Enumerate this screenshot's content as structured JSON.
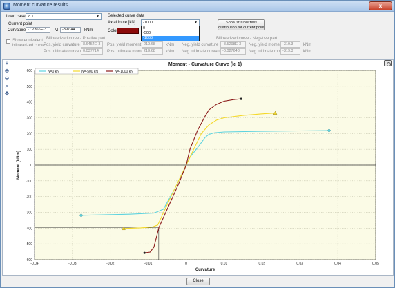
{
  "window": {
    "title": "Moment curvature results",
    "close_glyph": "x"
  },
  "load_case": {
    "label": "Load case",
    "value": "lc 1"
  },
  "current_point": {
    "heading": "Current point",
    "curvature_label": "Curvature",
    "curvature_value": "-7.2366E-3",
    "moment_label": "M",
    "moment_value": "-397.44",
    "unit": "kNm"
  },
  "selected_curve": {
    "heading": "Selected curve data",
    "axial_label": "Axial force [kN]",
    "axial_value": "-1000",
    "options": [
      "0",
      "-500",
      "-1000"
    ],
    "selected_option_index": 2,
    "color_label": "Color",
    "color_value": "#8b0a0a"
  },
  "show_button": {
    "line1": "Show strain/stress",
    "line2": "distribution for current point"
  },
  "equivalent": {
    "checkbox_label_1": "Show equivalent",
    "checkbox_label_2": "bilinearized curve"
  },
  "bilinear_pos": {
    "heading": "Bilinearized curve - Positive part",
    "yield_curv_label": "Pos. yield curvature",
    "yield_curv_value": "8.6454E-3",
    "ult_curv_label": "Pos. ultimate curvature",
    "ult_curv_value": "0.037714",
    "yield_mom_label": "Pos. yield moment",
    "yield_mom_value": "219.68",
    "ult_mom_label": "Pos. ultimate moment",
    "ult_mom_value": "219.68",
    "unit": "kNm"
  },
  "bilinear_neg": {
    "heading": "Bilinearized curve - Negative part",
    "yield_curv_label": "Neg. yield curvature",
    "yield_curv_value": "-8.5298E-3",
    "ult_curv_label": "Neg. ultimate curvature",
    "ult_curv_value": "-0.027648",
    "yield_mom_label": "Neg. yield moment",
    "yield_mom_value": "-319.3",
    "ult_mom_label": "Neg. ultimate moment",
    "ult_mom_value": "-319.3",
    "unit": "kNm"
  },
  "toolbar_icons": [
    "zoom-fit-icon",
    "zoom-in-icon",
    "zoom-out-icon",
    "zoom-window-icon",
    "pan-icon"
  ],
  "footer": {
    "close_label": "Close"
  },
  "chart_data": {
    "type": "line",
    "title": "Moment - Curvature Curve (lc 1)",
    "xlabel": "Curvature",
    "ylabel": "Moment [kNm]",
    "xlim": [
      -0.04,
      0.05
    ],
    "ylim": [
      -600,
      600
    ],
    "x_ticks": [
      -0.04,
      -0.03,
      -0.02,
      -0.01,
      0,
      0.01,
      0.02,
      0.03,
      0.04,
      0.05
    ],
    "y_ticks": [
      -600,
      -500,
      -400,
      -300,
      -200,
      -100,
      0,
      100,
      200,
      300,
      400,
      500,
      600
    ],
    "x_tick_labels": [
      "-0.04",
      "-0.03",
      "-0.02",
      "-0.01",
      "0",
      "0.01",
      "0.02",
      "0.03",
      "0.04",
      "0.05"
    ],
    "y_tick_labels": [
      "-600",
      "-500",
      "-400",
      "-300",
      "-200",
      "-100",
      "0",
      "100",
      "200",
      "300",
      "400",
      "500",
      "600"
    ],
    "grid": true,
    "legend_position": "top-left",
    "background": "#fbfbe6",
    "series": [
      {
        "name": "N=0 kN",
        "color": "#5ed3df",
        "marker": "diamond",
        "x": [
          -0.0277,
          -0.015,
          -0.0085,
          -0.006,
          -0.003,
          -0.001,
          0,
          0.001,
          0.003,
          0.005,
          0.006,
          0.0075,
          0.01,
          0.02,
          0.03,
          0.0377
        ],
        "y": [
          -319,
          -312,
          -305,
          -280,
          -150,
          -50,
          0,
          50,
          110,
          175,
          195,
          205,
          210,
          214,
          217,
          219
        ]
      },
      {
        "name": "N=-500 kN",
        "color": "#f4d82a",
        "marker": "triangle",
        "x": [
          -0.0165,
          -0.012,
          -0.009,
          -0.0075,
          -0.005,
          -0.002,
          0,
          0.002,
          0.004,
          0.006,
          0.008,
          0.01,
          0.015,
          0.02,
          0.0235
        ],
        "y": [
          -402,
          -398,
          -393,
          -380,
          -250,
          -100,
          0,
          100,
          200,
          255,
          285,
          300,
          315,
          325,
          330
        ]
      },
      {
        "name": "N=-1000 kN",
        "color": "#8b1a1a",
        "marker": "circle",
        "x": [
          -0.011,
          -0.0095,
          -0.0085,
          -0.0072,
          -0.005,
          -0.002,
          0,
          0.001,
          0.003,
          0.005,
          0.006,
          0.008,
          0.01,
          0.0125,
          0.0145
        ],
        "y": [
          -557,
          -552,
          -520,
          -397,
          -280,
          -120,
          0,
          100,
          220,
          310,
          350,
          385,
          405,
          415,
          420
        ]
      }
    ],
    "markers": [
      {
        "series": "N=0 kN",
        "shape": "diamond",
        "x": -0.0277,
        "y": -319
      },
      {
        "series": "N=0 kN",
        "shape": "diamond",
        "x": 0.0377,
        "y": 219
      },
      {
        "series": "N=-500 kN",
        "shape": "triangle",
        "x": -0.0165,
        "y": -402
      },
      {
        "series": "N=-500 kN",
        "shape": "triangle",
        "x": 0.0235,
        "y": 330
      },
      {
        "series": "N=-1000 kN",
        "shape": "circle",
        "x": -0.011,
        "y": -557
      },
      {
        "series": "N=-1000 kN",
        "shape": "circle",
        "x": 0.0145,
        "y": 420
      }
    ],
    "current_point": {
      "x": -0.0072366,
      "y": -397.44
    }
  }
}
